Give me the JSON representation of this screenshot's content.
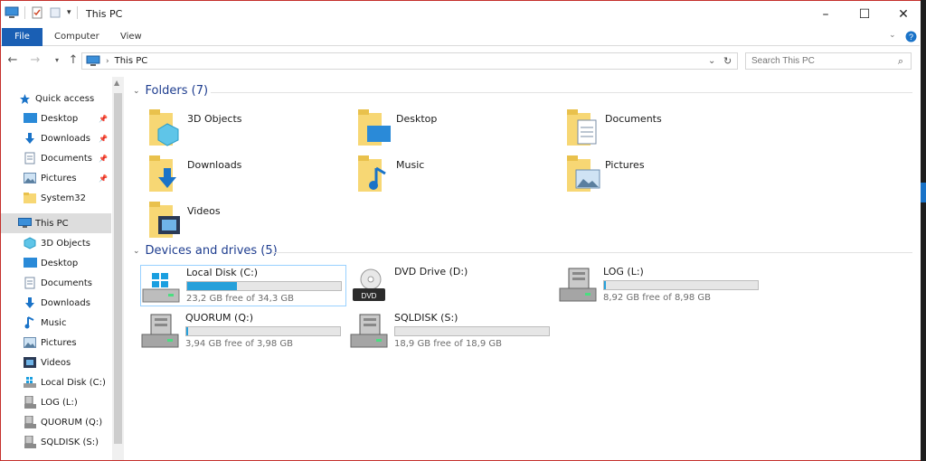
{
  "window": {
    "title": "This PC"
  },
  "ribbon": {
    "tabs": [
      "File",
      "Computer",
      "View"
    ]
  },
  "address": {
    "location": "This PC"
  },
  "search": {
    "placeholder": "Search This PC"
  },
  "sidebar": {
    "quick_access": "Quick access",
    "quick_items": [
      "Desktop",
      "Downloads",
      "Documents",
      "Pictures",
      "System32"
    ],
    "this_pc": "This PC",
    "pc_items": [
      "3D Objects",
      "Desktop",
      "Documents",
      "Downloads",
      "Music",
      "Pictures",
      "Videos",
      "Local Disk (C:)",
      "LOG (L:)",
      "QUORUM (Q:)",
      "SQLDISK (S:)"
    ]
  },
  "folders": {
    "header": "Folders (7)",
    "items": [
      "3D Objects",
      "Desktop",
      "Documents",
      "Downloads",
      "Music",
      "Pictures",
      "Videos"
    ]
  },
  "devices": {
    "header": "Devices and drives (5)",
    "drives": [
      {
        "name": "Local Disk (C:)",
        "free": "23,2 GB free of 34,3 GB",
        "used_fraction": 0.324,
        "icon": "windows-drive-icon"
      },
      {
        "name": "DVD Drive (D:)",
        "free": "",
        "used_fraction": null,
        "icon": "dvd-drive-icon"
      },
      {
        "name": "LOG (L:)",
        "free": "8,92 GB free of 8,98 GB",
        "used_fraction": 0.007,
        "icon": "server-drive-icon"
      },
      {
        "name": "QUORUM (Q:)",
        "free": "3,94 GB free of 3,98 GB",
        "used_fraction": 0.01,
        "icon": "server-drive-icon"
      },
      {
        "name": "SQLDISK (S:)",
        "free": "18,9 GB free of 18,9 GB",
        "used_fraction": 0.0,
        "icon": "server-drive-icon"
      }
    ]
  },
  "colors": {
    "accent": "#1a5fb4",
    "bar_fill": "#26a0da",
    "group_header": "#1e3d8f",
    "folder": "#f7d774"
  }
}
